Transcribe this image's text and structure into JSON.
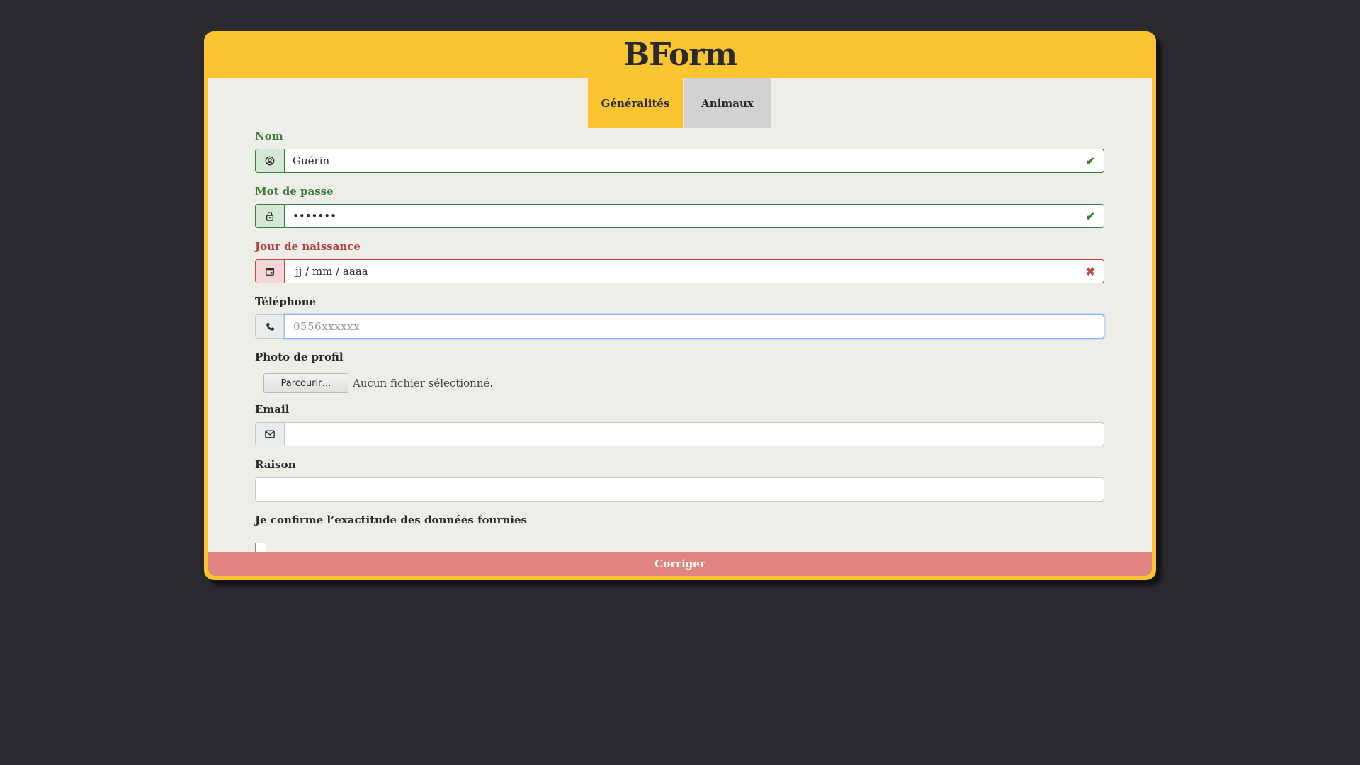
{
  "brand": {
    "title": "BForm"
  },
  "tabs": [
    {
      "label": "Généralités",
      "active": true
    },
    {
      "label": "Animaux",
      "active": false
    }
  ],
  "form": {
    "nom": {
      "label": "Nom",
      "value": "Guérin",
      "state": "valid",
      "icon": "user-circle-icon"
    },
    "password": {
      "label": "Mot de passe",
      "value": "•••••••",
      "state": "valid",
      "icon": "lock-icon"
    },
    "birthday": {
      "label": "Jour de naissance",
      "placeholder": "jj / mm / aaaa",
      "state": "invalid",
      "icon": "calendar-icon"
    },
    "phone": {
      "label": "Téléphone",
      "placeholder": "0556xxxxxx",
      "state": "focused",
      "icon": "phone-icon"
    },
    "photo": {
      "label": "Photo de profil",
      "button_label": "Parcourir…",
      "status_text": "Aucun fichier sélectionné."
    },
    "email": {
      "label": "Email",
      "value": "",
      "icon": "mail-icon"
    },
    "raison": {
      "label": "Raison",
      "value": ""
    },
    "confirm": {
      "label": "Je confirme l’exactitude des données fournies",
      "checked": false
    }
  },
  "submit": {
    "label": "Corriger"
  },
  "colors": {
    "background": "#2a292e",
    "accent": "#fbc531",
    "panel": "#eeeee8",
    "valid": "#3d7a3d",
    "invalid": "#c04a4a",
    "submit": "#e08580"
  }
}
